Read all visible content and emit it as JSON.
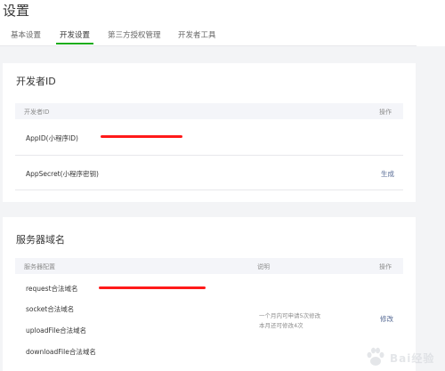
{
  "page": {
    "title": "设置"
  },
  "tabs": [
    {
      "label": "基本设置",
      "active": false
    },
    {
      "label": "开发设置",
      "active": true
    },
    {
      "label": "第三方授权管理",
      "active": false
    },
    {
      "label": "开发者工具",
      "active": false
    }
  ],
  "developer_id": {
    "title": "开发者ID",
    "header": {
      "col1": "开发者ID",
      "col2": "操作"
    },
    "rows": [
      {
        "label": "AppID(小程序ID)",
        "action": ""
      },
      {
        "label": "AppSecret(小程序密钥)",
        "action": "生成"
      }
    ]
  },
  "server_domain": {
    "title": "服务器域名",
    "header": {
      "col1": "服务器配置",
      "col2": "说明",
      "col3": "操作"
    },
    "rows": [
      {
        "label": "request合法域名"
      },
      {
        "label": "socket合法域名"
      },
      {
        "label": "uploadFile合法域名"
      },
      {
        "label": "downloadFile合法域名"
      }
    ],
    "note_line1": "一个月内可申请5次修改",
    "note_line2": "本月还可修改4次",
    "action": "修改"
  },
  "colors": {
    "accent": "#1aad19",
    "link": "#576b95",
    "redaction": "#ff1a1a"
  },
  "watermark": {
    "text": "Bai经验",
    "icon": "paw-icon"
  }
}
